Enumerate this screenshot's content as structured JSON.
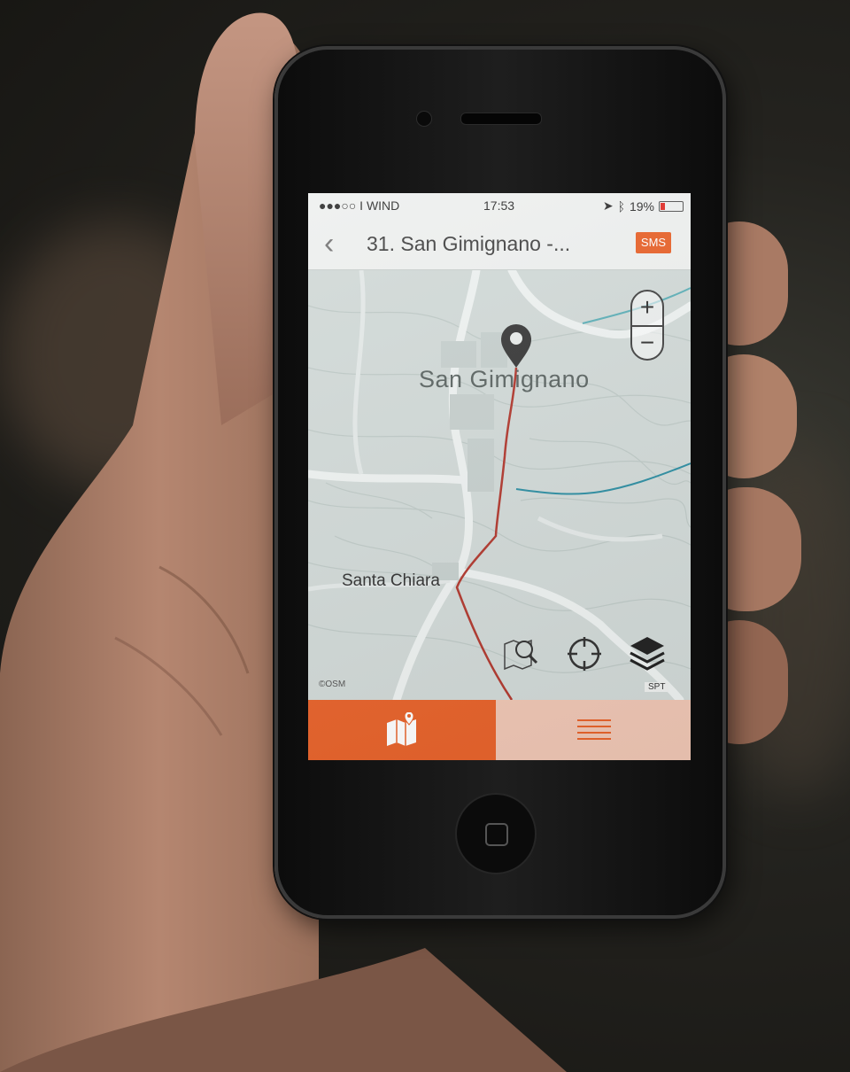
{
  "status_bar": {
    "carrier": "●●●○○ I WIND",
    "time": "17:53",
    "battery": "19%",
    "battery_level": 0.19
  },
  "nav": {
    "back_icon": "chevron-left-icon",
    "title": "31. San Gimignano -...",
    "sms_label": "SMS"
  },
  "map": {
    "labels": {
      "town_main": "San Gimignano",
      "town_secondary": "Santa Chiara"
    },
    "zoom_in": "+",
    "zoom_out": "−",
    "layer_badge": "SPT",
    "attribution": "©OSM",
    "tools": [
      "search-map-icon",
      "locate-crosshair-icon",
      "layers-icon"
    ],
    "route_color": "#b23a30"
  },
  "tabs": [
    {
      "name": "map",
      "icon": "map-icon",
      "active": true
    },
    {
      "name": "list",
      "icon": "menu-icon",
      "active": false
    }
  ],
  "colors": {
    "accent": "#e8632b",
    "tab_inactive": "#f0c7b5"
  }
}
